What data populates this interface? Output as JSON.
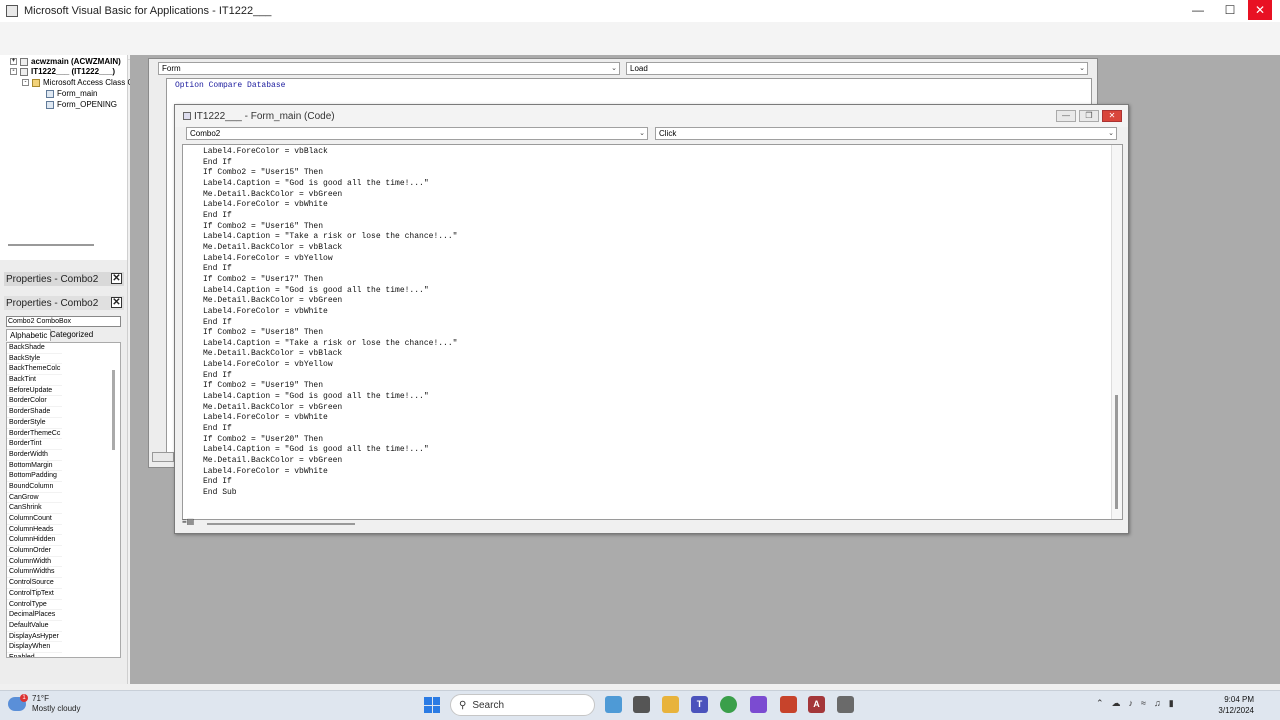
{
  "window": {
    "title": "Microsoft Visual Basic for Applications - IT1222___"
  },
  "project_tree": {
    "items": [
      {
        "label": "acwzmain (ACWZMAIN)",
        "level": 1,
        "bold": true
      },
      {
        "label": "IT1222___ (IT1222___)",
        "level": 1,
        "bold": true
      },
      {
        "label": "Microsoft Access Class O",
        "level": 2,
        "bold": false
      },
      {
        "label": "Form_main",
        "level": 3,
        "bold": false
      },
      {
        "label": "Form_OPENING",
        "level": 3,
        "bold": false
      }
    ]
  },
  "properties": {
    "title": "Properties - Combo2",
    "title_ghost": "Properties - Combo2",
    "object": "Combo2 ComboBox",
    "tabs": [
      "Alphabetic",
      "Categorized"
    ],
    "items": [
      "BackShade",
      "BackStyle",
      "BackThemeColc",
      "BackTint",
      "BeforeUpdate",
      "BorderColor",
      "BorderShade",
      "BorderStyle",
      "BorderThemeCc",
      "BorderTint",
      "BorderWidth",
      "BottomMargin",
      "BottomPadding",
      "BoundColumn",
      "CanGrow",
      "CanShrink",
      "ColumnCount",
      "ColumnHeads",
      "ColumnHidden",
      "ColumnOrder",
      "ColumnWidth",
      "ColumnWidths",
      "ControlSource",
      "ControlTipText",
      "ControlType",
      "DecimalPlaces",
      "DefaultValue",
      "DisplayAsHyper",
      "DisplayWhen",
      "Enabled"
    ]
  },
  "back_window": {
    "object_combo": "Form",
    "proc_combo": "Load",
    "first_line": "Option Compare Database"
  },
  "code_window": {
    "title": "IT1222___ - Form_main (Code)",
    "object_combo": "Combo2",
    "proc_combo": "Click",
    "lines": [
      "Label4.ForeColor = vbBlack",
      "End If",
      "If Combo2 = \"User15\" Then",
      "Label4.Caption = \"God is good all the time!...\"",
      "Me.Detail.BackColor = vbGreen",
      "Label4.ForeColor = vbWhite",
      "End If",
      "If Combo2 = \"User16\" Then",
      "Label4.Caption = \"Take a risk or lose the chance!...\"",
      "Me.Detail.BackColor = vbBlack",
      "Label4.ForeColor = vbYellow",
      "End If",
      "If Combo2 = \"User17\" Then",
      "Label4.Caption = \"God is good all the time!...\"",
      "Me.Detail.BackColor = vbGreen",
      "Label4.ForeColor = vbWhite",
      "End If",
      "If Combo2 = \"User18\" Then",
      "Label4.Caption = \"Take a risk or lose the chance!...\"",
      "Me.Detail.BackColor = vbBlack",
      "Label4.ForeColor = vbYellow",
      "End If",
      "If Combo2 = \"User19\" Then",
      "Label4.Caption = \"God is good all the time!...\"",
      "Me.Detail.BackColor = vbGreen",
      "Label4.ForeColor = vbWhite",
      "End If",
      "If Combo2 = \"User20\" Then",
      "Label4.Caption = \"God is good all the time!...\"",
      "Me.Detail.BackColor = vbGreen",
      "Label4.ForeColor = vbWhite",
      "End If",
      "End Sub"
    ]
  },
  "taskbar": {
    "weather_temp": "71°F",
    "weather_desc": "Mostly cloudy",
    "weather_badge": "1",
    "search_placeholder": "Search",
    "time": "9:04 PM",
    "date": "3/12/2024"
  },
  "colors": {
    "close_red": "#e81123",
    "code_keyword_blue": "#1a1a9e"
  }
}
